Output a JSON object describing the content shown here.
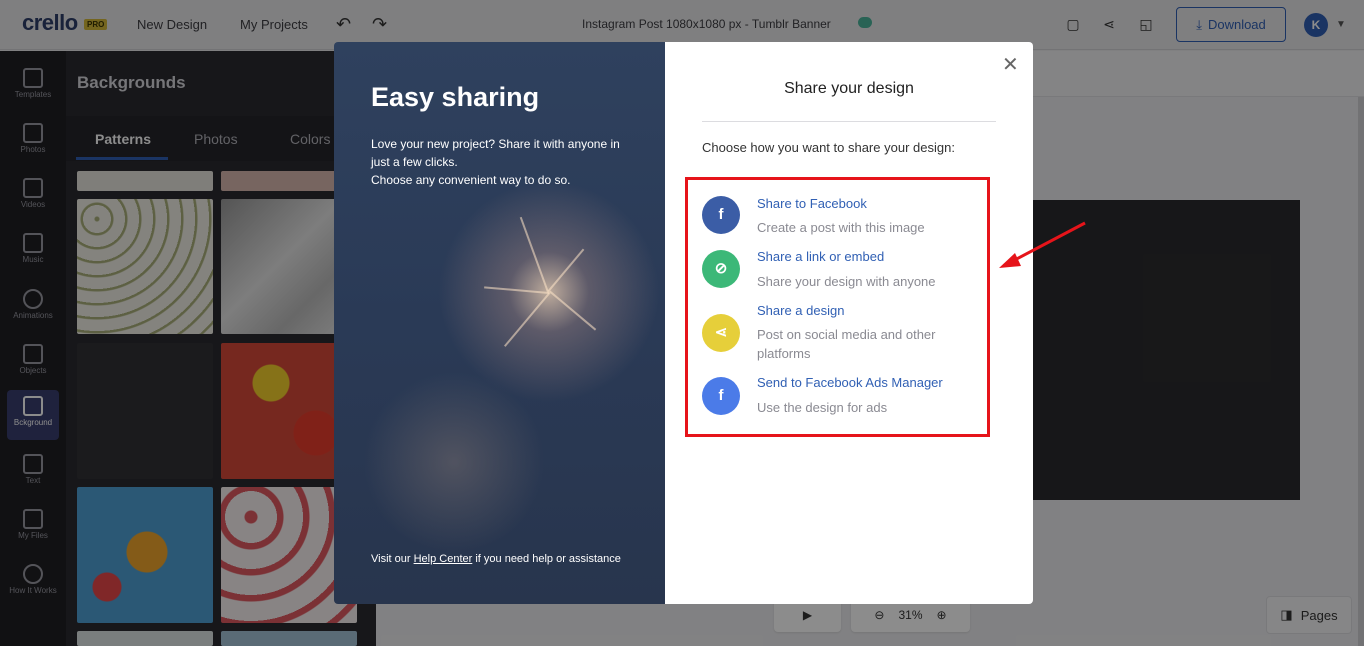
{
  "app": {
    "logo": "crello",
    "badge": "PRO",
    "nav": [
      "New Design",
      "My Projects"
    ],
    "undo_icon": "undo-icon",
    "redo_icon": "redo-icon",
    "doc_title": "Instagram Post 1080x1080 px - Tumblr Banner",
    "download_label": "Download",
    "avatar_initial": "K"
  },
  "rail": [
    {
      "label": "Templates",
      "icon": "templates-icon"
    },
    {
      "label": "Photos",
      "icon": "photos-icon"
    },
    {
      "label": "Videos",
      "icon": "videos-icon"
    },
    {
      "label": "Music",
      "icon": "music-icon"
    },
    {
      "label": "Animations",
      "icon": "animations-icon"
    },
    {
      "label": "Objects",
      "icon": "objects-icon"
    },
    {
      "label": "Bckground",
      "icon": "background-icon",
      "active": true
    },
    {
      "label": "Text",
      "icon": "text-icon"
    },
    {
      "label": "My Files",
      "icon": "folder-icon"
    },
    {
      "label": "How It Works",
      "icon": "help-icon"
    }
  ],
  "panel": {
    "title": "Backgrounds",
    "tabs": [
      "Patterns",
      "Photos",
      "Colors"
    ],
    "active_tab": "Patterns"
  },
  "controls": {
    "zoom": "31%",
    "pages_label": "Pages"
  },
  "modal": {
    "left": {
      "heading": "Easy sharing",
      "intro_line1": "Love your new project? Share it with anyone in just a few clicks.",
      "intro_line2": "Choose any convenient way to do so.",
      "help_prefix": "Visit our ",
      "help_link": "Help Center",
      "help_suffix": " if you need help or assistance"
    },
    "right": {
      "title": "Share your design",
      "subtitle": "Choose how you want to share your design:",
      "options": [
        {
          "title": "Share to Facebook",
          "desc": "Create a post with this image",
          "icon": "facebook-icon",
          "color": "#3b5da6"
        },
        {
          "title": "Share a link or embed",
          "desc": "Share your design with anyone",
          "icon": "link-icon",
          "color": "#3cb878"
        },
        {
          "title": "Share a design",
          "desc": "Post on social media and other platforms",
          "icon": "share-icon",
          "color": "#e6cf3a"
        },
        {
          "title": "Send to Facebook Ads Manager",
          "desc": "Use the design for ads",
          "icon": "facebook-ads-icon",
          "color": "#4b7be8"
        }
      ]
    }
  },
  "annotation_color": "#e6141a"
}
